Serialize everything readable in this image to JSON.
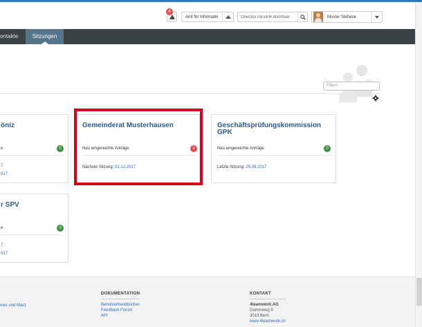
{
  "header": {
    "notifications_count": "4",
    "org_unit": "Amt für Informatik",
    "search_placeholder": "OneGov GEVER durchsuc",
    "user_name": "Muster Stefanie"
  },
  "nav": {
    "tabs": [
      {
        "label": "ontakte",
        "active": false
      },
      {
        "label": "Sitzungen",
        "active": true
      }
    ]
  },
  "toolbar": {
    "filter_placeholder": "Filtern"
  },
  "cards": [
    {
      "title": "öniz",
      "row1_label": "e",
      "row1_count": "0",
      "row1_color": "green",
      "row2_prefix": "",
      "row2_date_line1": "7",
      "row2_date_line2": "017"
    },
    {
      "title": "Gemeinderat Musterhausen",
      "row1_label": "Neu eingereichte Anträge",
      "row1_count": "3",
      "row1_color": "red",
      "row2_prefix": "Nächste Sitzung: ",
      "row2_date": "01.12.2017"
    },
    {
      "title_line1": "Geschäftsprüfungskommission",
      "title_line2": "GPK",
      "row1_label": "Neu eingereichte Anträge",
      "row1_count": "0",
      "row1_color": "green",
      "row2_prefix": "Letzte Sitzung: ",
      "row2_date": "25.09.2017"
    },
    {
      "title": "r SPV",
      "row1_label": "e",
      "row1_count": "0",
      "row1_color": "green",
      "row2_date_line1": "7",
      "row2_date_line2": "017"
    }
  ],
  "footer": {
    "col1_link": "ows und Mac)",
    "dokumentation": {
      "heading": "DOKUMENTATION",
      "links": [
        "Benutzerhandbücher",
        "Feedback Forum",
        "API"
      ]
    },
    "kontakt": {
      "heading": "KONTAKT",
      "company": "4teamwork AG",
      "street": "Dammweg 9",
      "city": "3013 Bern",
      "web": "www.4teamwork.ch"
    }
  },
  "colors": {
    "nav_bg": "#3b4246",
    "nav_active": "#56748a",
    "title_blue": "#2a5a8c",
    "link_blue": "#2a6ab8",
    "badge_green": "#3f8f3f",
    "badge_red": "#e04b4b",
    "highlight": "#d4001a"
  }
}
